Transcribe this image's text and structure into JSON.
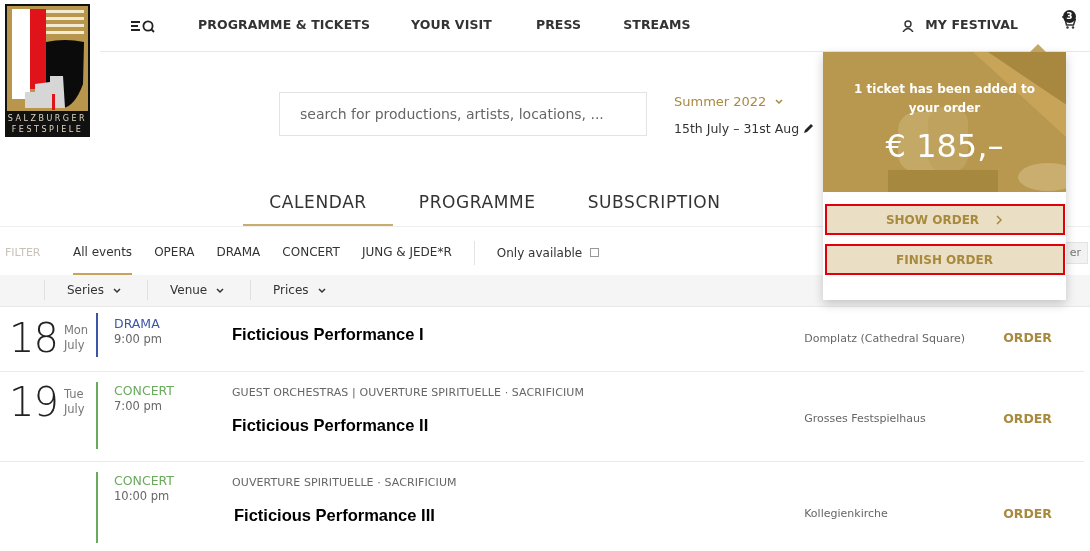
{
  "logo": {
    "lines": [
      "SALZBURGER",
      "FESTSPIELE"
    ]
  },
  "nav": {
    "items": [
      "PROGRAMME & TICKETS",
      "YOUR VISIT",
      "PRESS",
      "STREAMS"
    ],
    "my_festival": "MY FESTIVAL",
    "cart_count": "3"
  },
  "search": {
    "placeholder": "search for productions, artists, locations, ..."
  },
  "season": {
    "label": "Summer 2022",
    "dates": "15th July – 31st Aug"
  },
  "view_tabs": [
    {
      "label": "CALENDAR",
      "selected": true
    },
    {
      "label": "PROGRAMME",
      "selected": false
    },
    {
      "label": "SUBSCRIPTION",
      "selected": false
    }
  ],
  "filters": {
    "label": "FILTER",
    "categories": [
      {
        "label": "All events",
        "selected": true
      },
      {
        "label": "OPERA",
        "selected": false
      },
      {
        "label": "DRAMA",
        "selected": false
      },
      {
        "label": "CONCERT",
        "selected": false
      },
      {
        "label": "JUNG & JEDE*R",
        "selected": false
      }
    ],
    "only_available": {
      "label": "Only available",
      "checked": false
    },
    "partial_button": "er"
  },
  "dropdowns": [
    "Series",
    "Venue",
    "Prices"
  ],
  "events": [
    {
      "day": "18",
      "weekday": "Mon",
      "month": "July",
      "category": "DRAMA",
      "color": "#3d55a6",
      "time": "9:00 pm",
      "title": "Ficticious Performance I",
      "venue": "Domplatz (Cathedral Square)",
      "action": "ORDER"
    },
    {
      "day": "19",
      "weekday": "Tue",
      "month": "July",
      "category": "CONCERT",
      "color": "#6aaa5c",
      "time": "7:00 pm",
      "series": "GUEST ORCHESTRAS | OUVERTURE SPIRITUELLE · SACRIFICIUM",
      "title": "Ficticious Performance II",
      "venue": "Grosses Festspielhaus",
      "action": "ORDER"
    },
    {
      "category": "CONCERT",
      "color": "#6aaa5c",
      "time": "10:00 pm",
      "series": "OUVERTURE SPIRITUELLE · SACRIFICIUM",
      "title": "Ficticious Performance III",
      "venue": "Kollegienkirche",
      "action": "ORDER"
    }
  ],
  "cart_popup": {
    "message": "1 ticket has been added to your order",
    "price": "€ 185,–",
    "buttons": [
      {
        "label": "SHOW ORDER",
        "kind": "link",
        "highlighted": true
      },
      {
        "label": "FINISH ORDER",
        "kind": "plain",
        "highlighted": true
      }
    ]
  }
}
